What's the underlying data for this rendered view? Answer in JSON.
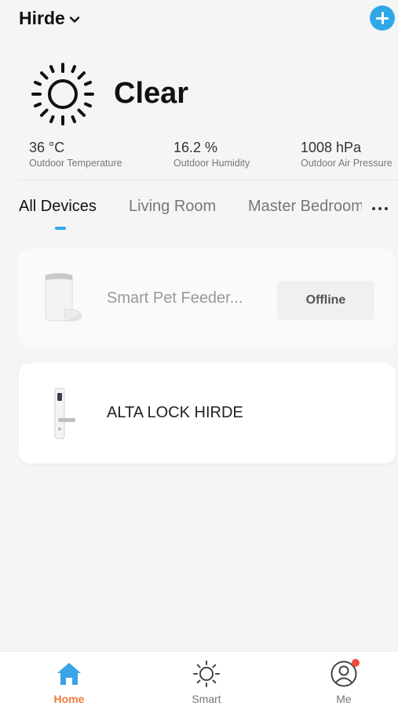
{
  "header": {
    "home_name": "Hirde",
    "add_icon": "plus-circle-icon"
  },
  "weather": {
    "icon": "sun-icon",
    "condition": "Clear",
    "stats": [
      {
        "value": "36 °C",
        "label": "Outdoor Temperature"
      },
      {
        "value": "16.2 %",
        "label": "Outdoor Humidity"
      },
      {
        "value": "1008 hPa",
        "label": "Outdoor Air Pressure"
      }
    ]
  },
  "tabs": {
    "items": [
      {
        "label": "All Devices",
        "active": true
      },
      {
        "label": "Living Room",
        "active": false
      },
      {
        "label": "Master Bedroom",
        "active": false
      }
    ],
    "more_icon": "more-horizontal-icon"
  },
  "devices": [
    {
      "name": "Smart Pet Feeder...",
      "status": "Offline",
      "icon": "pet-feeder-image"
    },
    {
      "name": "ALTA LOCK HIRDE",
      "status": "",
      "icon": "door-lock-image"
    }
  ],
  "bottom_nav": {
    "items": [
      {
        "label": "Home",
        "icon": "home-icon",
        "active": true
      },
      {
        "label": "Smart",
        "icon": "sun-outline-icon",
        "active": false
      },
      {
        "label": "Me",
        "icon": "user-circle-icon",
        "active": false
      }
    ]
  },
  "colors": {
    "accent": "#2fa8e8",
    "active_nav": "#f07a3a",
    "notification": "#f04b3c"
  }
}
